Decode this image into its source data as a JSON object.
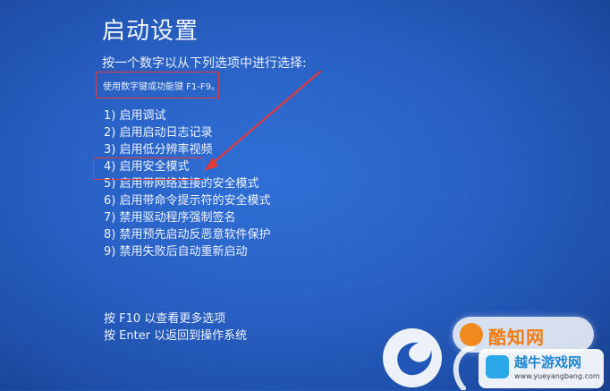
{
  "screen": {
    "title": "启动设置",
    "instruction": "按一个数字以从下列选项中进行选择:",
    "hint": "使用数字键或功能键 F1-F9。"
  },
  "options": [
    {
      "label": "1) 启用调试"
    },
    {
      "label": "2) 启用启动日志记录"
    },
    {
      "label": "3) 启用低分辨率视频"
    },
    {
      "label": "4) 启用安全模式"
    },
    {
      "label": "5) 启用带网络连接的安全模式"
    },
    {
      "label": "6) 启用带命令提示符的安全模式"
    },
    {
      "label": "7) 禁用驱动程序强制签名"
    },
    {
      "label": "8) 禁用预先启动反恶意软件保护"
    },
    {
      "label": "9) 禁用失败后自动重新启动"
    }
  ],
  "footer": {
    "more_options": "按 F10 以查看更多选项",
    "return": "按 Enter 以返回到操作系统"
  },
  "watermark": {
    "brand": "酷知网",
    "site_title": "越牛游戏网",
    "site_url": "www.yueyangbang.com"
  },
  "colors": {
    "background": "#2a62c6",
    "annotation": "#e23a3a",
    "watermark_orange": "#f07d12",
    "watermark_blue": "#1d86d1"
  }
}
